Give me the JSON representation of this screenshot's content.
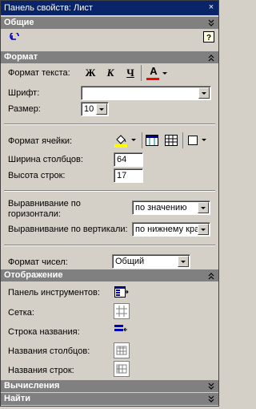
{
  "window": {
    "title": "Панель свойств: Лист",
    "close_glyph": "×"
  },
  "sections": {
    "general": "Общие",
    "format": "Формат",
    "display": "Отображение",
    "calc": "Вычисления",
    "find": "Найти"
  },
  "format": {
    "text_format_label": "Формат текста:",
    "bold": "Ж",
    "italic": "К",
    "underline": "Ч",
    "font_color_letter": "A",
    "font_label": "Шрифт:",
    "font_value": "",
    "size_label": "Размер:",
    "size_value": "10",
    "cell_format_label": "Формат ячейки:",
    "col_width_label": "Ширина столбцов:",
    "col_width_value": "64",
    "row_height_label": "Высота строк:",
    "row_height_value": "17",
    "halign_label_1": "Выравнивание по",
    "halign_label_2": "горизонтали:",
    "halign_value": "по значению",
    "valign_label": "Выравнивание по вертикали:",
    "valign_value": "по нижнему кра",
    "number_format_label": "Формат чисел:",
    "number_format_value": "Общий"
  },
  "display": {
    "toolbar_label": "Панель инструментов:",
    "grid_label": "Сетка:",
    "titlebar_label": "Строка названия:",
    "col_headers_label": "Названия столбцов:",
    "row_headers_label": "Названия строк:"
  },
  "colors": {
    "title_bg": "#0a246a",
    "section_bg": "#808080",
    "face": "#d4d0c8",
    "font_color_bar": "#ff0000",
    "fill_color_bar": "#ffff00"
  }
}
